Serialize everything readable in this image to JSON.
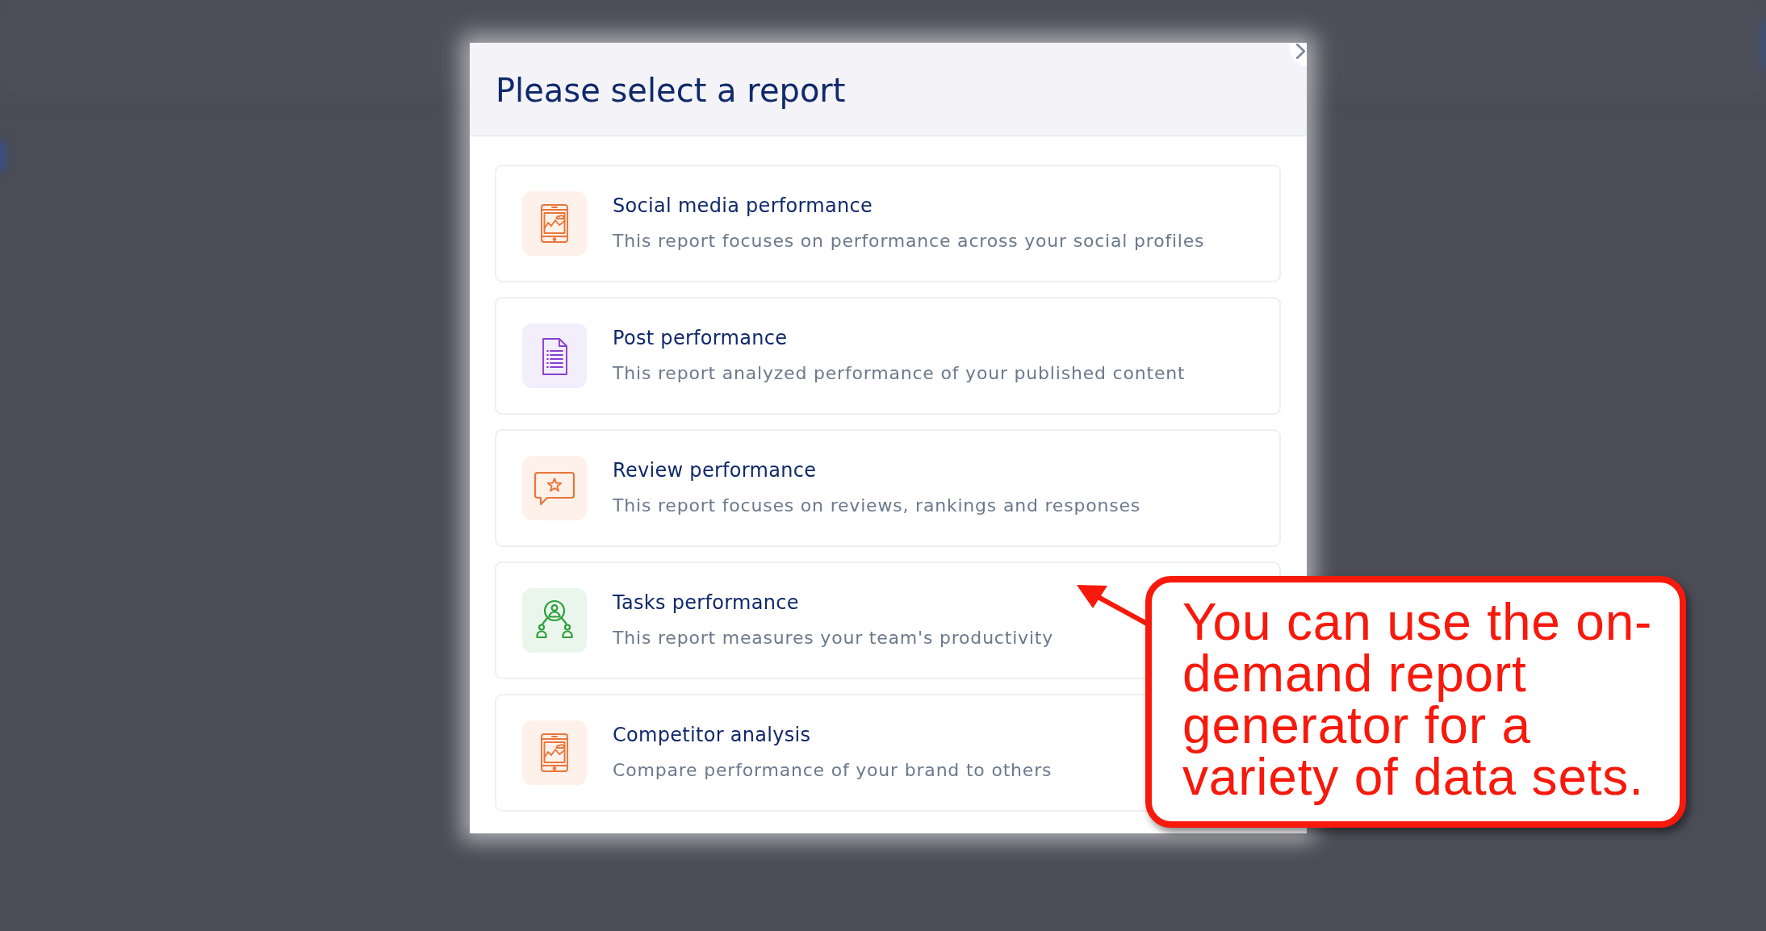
{
  "dialog": {
    "title": "Please select a report",
    "reports": [
      {
        "kind": "tablet",
        "title": "Social media performance",
        "description": "This report focuses on performance across your social profiles"
      },
      {
        "kind": "document",
        "title": "Post performance",
        "description": "This report analyzed performance of your published content"
      },
      {
        "kind": "review",
        "title": "Review performance",
        "description": "This report focuses on reviews, rankings and responses"
      },
      {
        "kind": "team",
        "title": "Tasks performance",
        "description": "This report measures your team's productivity"
      },
      {
        "kind": "tablet",
        "title": "Competitor analysis",
        "description": "Compare performance of your brand to others"
      }
    ]
  },
  "annotation": {
    "text": "You can use the on-demand report generator for a variety of data sets."
  }
}
